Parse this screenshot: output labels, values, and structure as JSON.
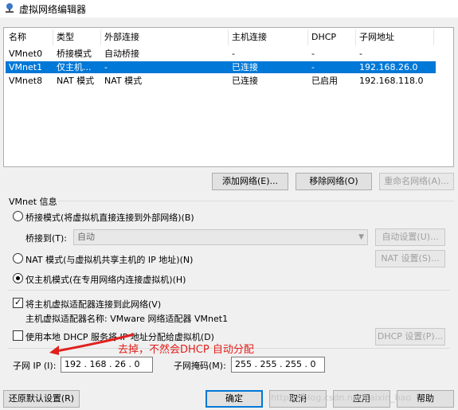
{
  "window": {
    "title": "虚拟网络编辑器"
  },
  "table": {
    "headers": [
      "名称",
      "类型",
      "外部连接",
      "主机连接",
      "DHCP",
      "子网地址"
    ],
    "rows": [
      {
        "name": "VMnet0",
        "type": "桥接模式",
        "ext": "自动桥接",
        "host": "-",
        "dhcp": "-",
        "subnet": "-"
      },
      {
        "name": "VMnet1",
        "type": "仅主机...",
        "ext": "-",
        "host": "已连接",
        "dhcp": "-",
        "subnet": "192.168.26.0"
      },
      {
        "name": "VMnet8",
        "type": "NAT 模式",
        "ext": "NAT 模式",
        "host": "已连接",
        "dhcp": "已启用",
        "subnet": "192.168.118.0"
      }
    ],
    "selected_row": "VMnet1"
  },
  "net_buttons": {
    "add": "添加网络(E)...",
    "remove": "移除网络(O)",
    "rename": "重命名网络(A)..."
  },
  "vmnet_info": {
    "group_title": "VMnet 信息",
    "bridge_radio": "桥接模式(将虚拟机直接连接到外部网络)(B)",
    "bridge_to_label": "桥接到(T):",
    "bridge_to_value": "自动",
    "auto_settings": "自动设置(U)...",
    "nat_radio": "NAT 模式(与虚拟机共享主机的 IP 地址)(N)",
    "nat_settings": "NAT 设置(S)...",
    "hostonly_radio": "仅主机模式(在专用网络内连接虚拟机)(H)",
    "selected_mode": "host-only",
    "connect_adapter": "将主机虚拟适配器连接到此网络(V)",
    "connect_adapter_checked": true,
    "adapter_name": "主机虚拟适配器名称: VMware 网络适配器 VMnet1",
    "use_dhcp": "使用本地 DHCP 服务将 IP 地址分配给虚拟机(D)",
    "use_dhcp_checked": false,
    "dhcp_settings": "DHCP 设置(P)...",
    "subnet_ip_label": "子网 IP (I):",
    "subnet_ip": "192 . 168 . 26 . 0",
    "subnet_mask_label": "子网掩码(M):",
    "subnet_mask": "255 . 255 . 255 . 0"
  },
  "annotation": "去掉，不然会DHCP 自动分配",
  "footer": {
    "restore": "还原默认设置(R)",
    "ok": "确定",
    "cancel": "取消",
    "apply": "应用",
    "help": "帮助"
  },
  "watermark": "https://blog.csdn.net/kaixin_bao",
  "colors": {
    "selection": "#0078d7",
    "annotation": "#e0201c"
  }
}
